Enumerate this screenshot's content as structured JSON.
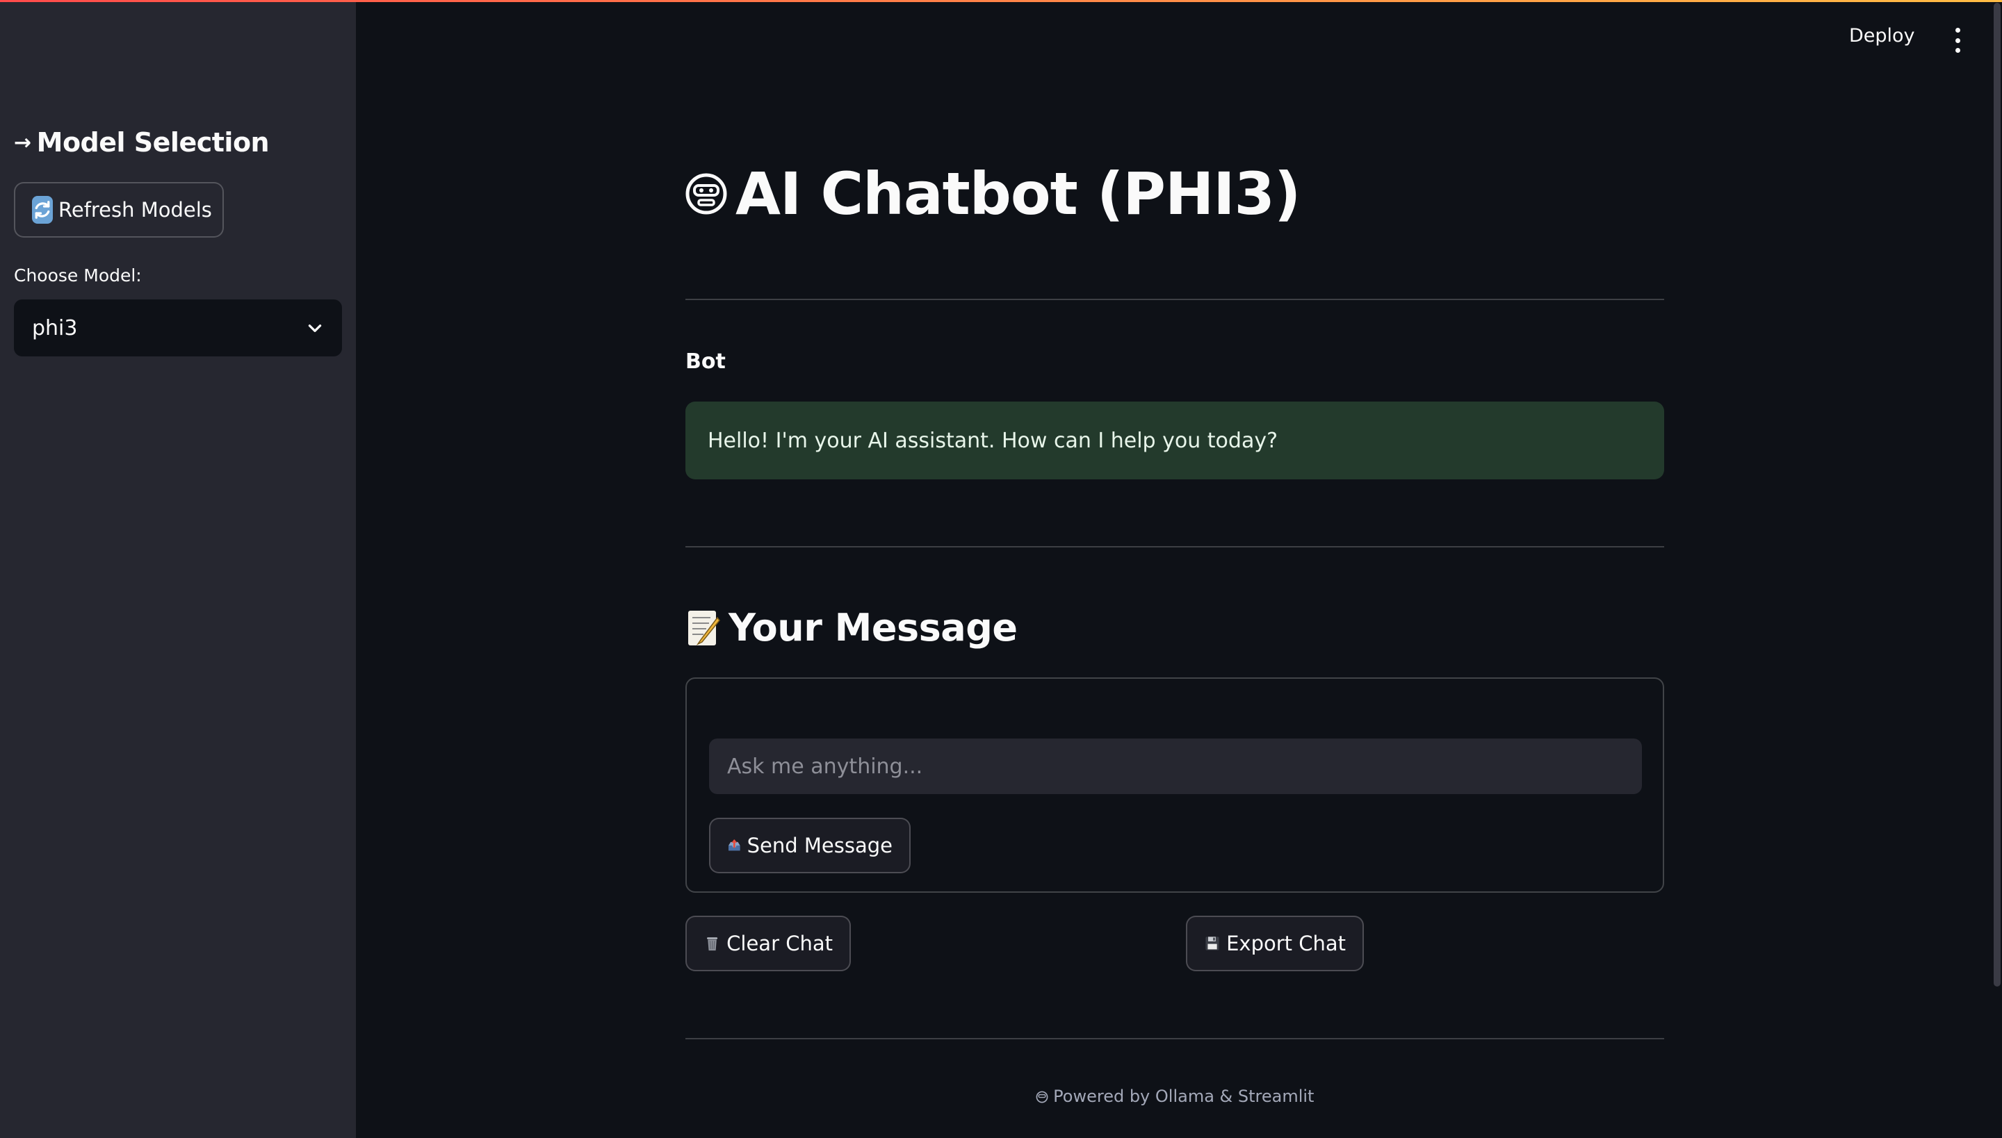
{
  "sidebar": {
    "title": "Model Selection",
    "title_icon": "arrow-right-icon",
    "refresh_label": "Refresh Models",
    "refresh_icon": "refresh-icon",
    "choose_label": "Choose Model:",
    "selected_model": "phi3"
  },
  "header": {
    "deploy_label": "Deploy",
    "menu_icon": "kebab-menu-icon"
  },
  "main": {
    "title": "AI Chatbot (PHI3)",
    "title_icon": "robot-face-icon",
    "bot_label": "Bot",
    "bot_message": "Hello! I'm your AI assistant. How can I help you today?",
    "message_section_title": "Your Message",
    "message_section_icon": "memo-icon",
    "input_placeholder": "Ask me anything...",
    "input_value": "",
    "send_label": "Send Message",
    "send_icon": "outbox-tray-icon",
    "clear_label": "Clear Chat",
    "clear_icon": "wastebasket-icon",
    "export_label": "Export Chat",
    "export_icon": "floppy-disk-icon",
    "footer": "Powered by Ollama & Streamlit",
    "footer_icon": "robot-face-icon"
  },
  "colors": {
    "background": "#0e1117",
    "sidebar": "#262730",
    "bot_bubble": "#233a2c",
    "accent_gradient_start": "#ff4b4b",
    "accent_gradient_end": "#ffbd45"
  }
}
